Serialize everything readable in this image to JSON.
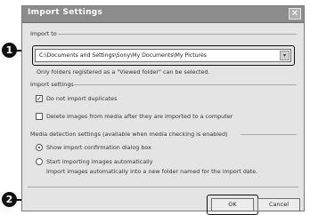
{
  "dialog": {
    "title": "Import Settings",
    "close_glyph": "✕"
  },
  "callouts": {
    "one": "1",
    "two": "2"
  },
  "import_to": {
    "label": "Import to",
    "path": "C:\\Documents and Settings\\Sony\\My Documents\\My Pictures",
    "dropdown_glyph": "▾",
    "note": "Only folders registered as a \"Viewed folder\" can be selected."
  },
  "import_settings": {
    "label": "Import settings",
    "do_not_import_duplicates": {
      "label": "Do not import duplicates",
      "checked": true
    },
    "delete_images": {
      "label": "Delete images from media after they are imported to a computer",
      "checked": false
    }
  },
  "media_detection": {
    "label": "Media detection settings (available when media checking is enabled)",
    "show_dialog": {
      "label": "Show import confirmation dialog box",
      "selected": true
    },
    "start_auto": {
      "label": "Start importing images automatically",
      "selected": false
    },
    "start_auto_note": "Import images automatically into a new folder named for the import date."
  },
  "buttons": {
    "ok": "OK",
    "cancel": "Cancel"
  },
  "check_glyph": "✓"
}
